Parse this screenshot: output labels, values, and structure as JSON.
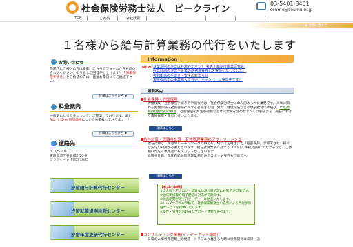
{
  "header": {
    "title": "社会保険労務士法人　ピークライン",
    "phone": "03-5401-3461",
    "email": "soumu@soumu.or.jp"
  },
  "nav": {
    "items": [
      "TOP",
      "ご挨拶",
      "会社概要",
      "",
      "",
      "",
      ""
    ]
  },
  "breadcrumb": "▶ お問い合わせ",
  "hero": {
    "title": "１名様から給与計算業務の代行をいたします"
  },
  "left": {
    "contact": {
      "title": "お問い合わせ",
      "body": "前向きにご検討の方は是非、こちらのフォームからお問い合わせください。折り返しご回答申し上げます！",
      "red": "「労働保険手続き」",
      "body2": "をご希望の方は、直接お電話にてご連絡下さい！！",
      "button": "詳細はこちらから ▶"
    },
    "price": {
      "title": "料金案内",
      "body": "一番気になる料金について、ご提案しております。また、",
      "red": "ALL in One 特別価格",
      "body2": "についても掲載しております！！",
      "button": "詳細はこちらから ▶"
    },
    "access": {
      "title": "連絡先",
      "zip": "〒105-0021",
      "addr1": "東京都港区東新橋2-10-4",
      "addr2": "グラディート汐留2F1003"
    },
    "banners": [
      "汐留給与計算代行センター",
      "汐留就業規則診断センター",
      "汐留年度更新代行センター"
    ]
  },
  "info": {
    "title": "Information",
    "new_tag": "NEW!",
    "news": "就業規則の作成はお済みですか？(社労士新制度開業研究会)",
    "news2": "経営計画の作成や企業の財務体質強化を実施いたしました。",
    "news3": "労務関係の手続き・安全のお知らせ",
    "news4": "東京都内での事業拡大に伴い、キャンペーン実施中です！"
  },
  "business": {
    "title": "業務案内",
    "services": [
      {
        "title": "社会保険・労働保険",
        "body": "労働保険・社会保険手続きの申請代行は、社会保険労務士にのみ認められた業務です。人事に関わる労働保険・社会保険に関する手続きの他、労災・健康保険などの保険給付の手続き、",
        "green": "年度更新(労働保険)の申告",
        "body2": "、社会保険の算定基礎届など年次業務を含めたすべての手続きを、責任にわかり書類作成・提出代行いたします。",
        "button": "詳細はこちら"
      },
      {
        "title": "給与計算・退職金計算・有休管理業務のアウトソーシング",
        "body": "給与計算は、毎月のルーチンワークの中でも、特に「正確さ」と「秘密保持」が要求され、様々な法令の知識が必要とされます。給与計算業務に対するコスト(人件費)削減につながるなど、ご依頼いただく事業者にもメリットがございます。",
        "body2": "退職金計算、年次有給休暇管理業務のみのスポット受託も可能です。",
        "button": "詳細はこちら"
      },
      {
        "title": "コンサルティング業務(インターネット顧問)",
        "body": "日常の人事労務管理上の問題・トラブルが発生した時に労務関係の法律・通"
      }
    ]
  },
  "features": {
    "title": "【私共の特徴】",
    "items": [
      "①少人数・アナログ・煩雑な給与計算処理にも対応が可能です。",
      "②給与明細書の電子配信に対応が可能です。",
      "③納品期間が短くスピーディーに納品いたします。",
      "④リーズナブルな価格で、社会保険労務士の提案による高付加価値サービスを提供いたします。",
      "⑤女性・男性のお好みのサポート体制が選べます。"
    ]
  },
  "colors": {
    "accent_orange": "#f29b21",
    "link_blue": "#1a44b8",
    "red": "#cc2222",
    "green": "#2a7a10"
  }
}
